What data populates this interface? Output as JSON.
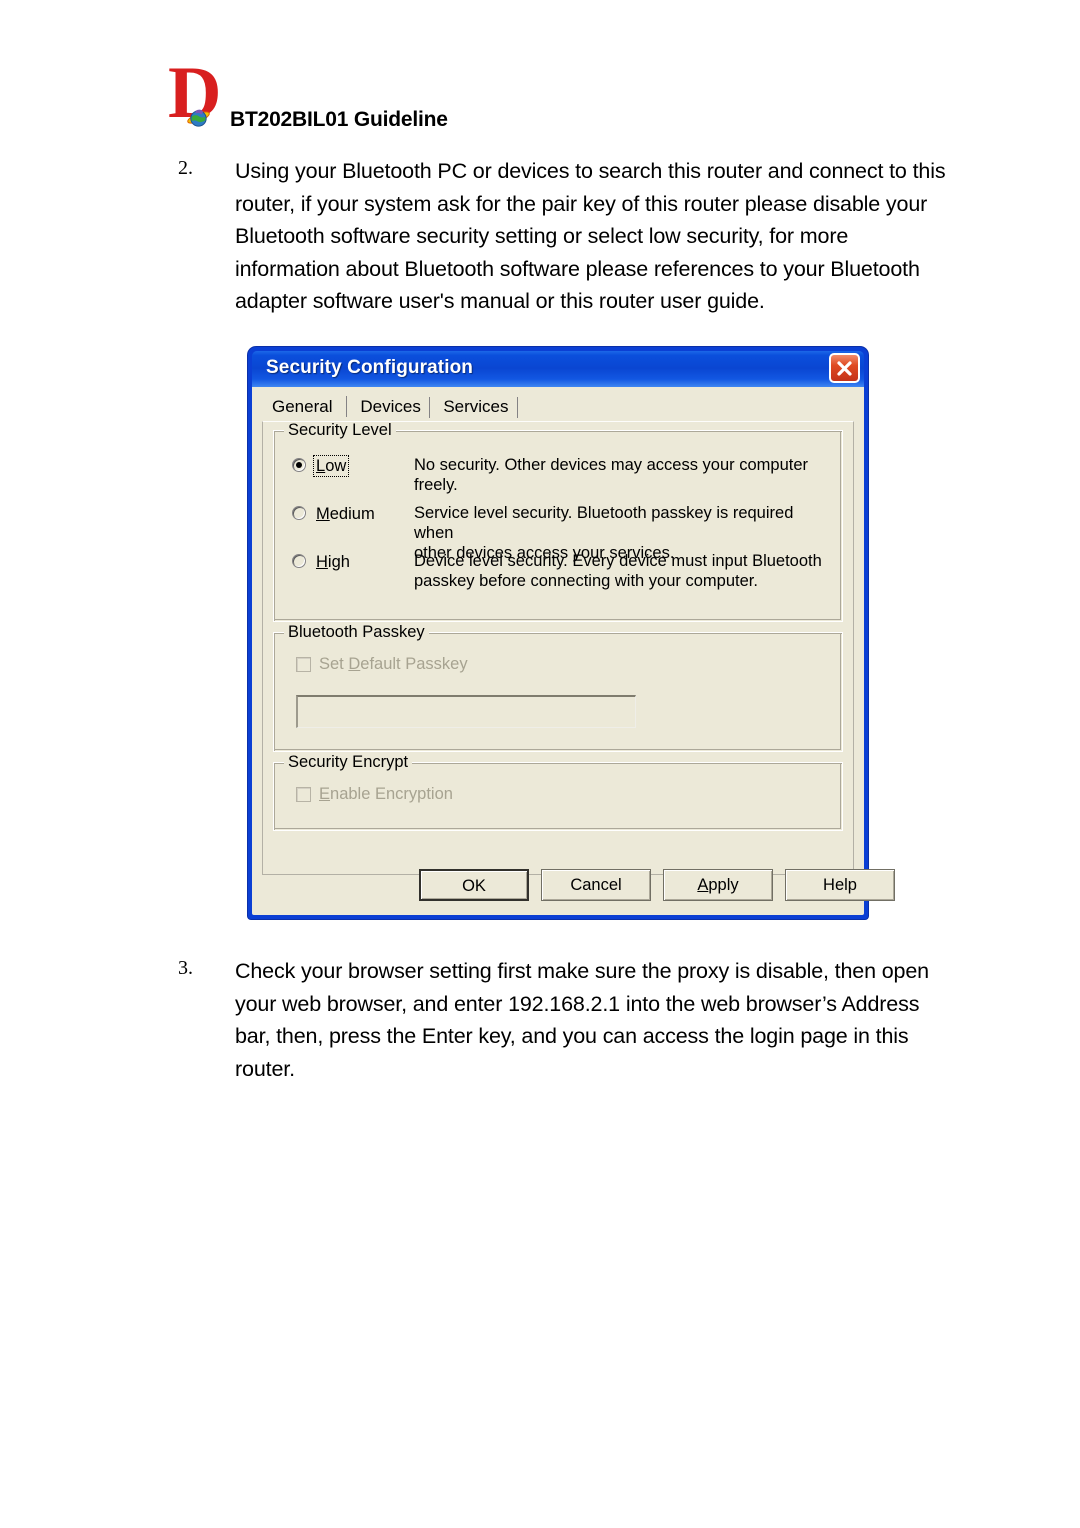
{
  "header": {
    "logo_letter": "D",
    "title": "BT202BIL01 Guideline"
  },
  "steps": [
    {
      "number": "2.",
      "text": "Using your Bluetooth PC or devices to search this router and connect to this router, if your system ask for the pair key of this router please disable your Bluetooth software security setting or select low security, for more information about Bluetooth software please references to your Bluetooth adapter software user's manual or this router user guide."
    },
    {
      "number": "3.",
      "text": "Check your browser setting first make sure the proxy is disable, then open your web browser, and enter 192.168.2.1 into the web browser’s Address bar, then, press the Enter key, and you can access the login page in this router."
    }
  ],
  "dialog": {
    "title": "Security Configuration",
    "close_label": "✕",
    "tabs": [
      {
        "label": "General",
        "active": true
      },
      {
        "label": "Devices",
        "active": false
      },
      {
        "label": "Services",
        "active": false
      }
    ],
    "security_level": {
      "group_title": "Security Level",
      "options": [
        {
          "label": "Low",
          "accel": "L",
          "selected": true,
          "focused": true,
          "desc_line1": "No security. Other devices may access your computer freely.",
          "desc_line2": ""
        },
        {
          "label": "Medium",
          "accel": "M",
          "selected": false,
          "focused": false,
          "desc_line1": "Service level security. Bluetooth passkey is required when",
          "desc_line2": "other devices access your services."
        },
        {
          "label": "High",
          "accel": "H",
          "selected": false,
          "focused": false,
          "desc_line1": "Device level security. Every device must input Bluetooth",
          "desc_line2": "passkey before connecting with your computer."
        }
      ]
    },
    "passkey": {
      "group_title": "Bluetooth Passkey",
      "checkbox_label": "Set Default Passkey",
      "checkbox_accel": "D",
      "checkbox_checked": false,
      "checkbox_disabled": true,
      "input_value": "",
      "input_disabled": true
    },
    "encrypt": {
      "group_title": "Security Encrypt",
      "checkbox_label": "Enable Encryption",
      "checkbox_accel": "E",
      "checkbox_checked": false,
      "checkbox_disabled": true
    },
    "buttons": [
      {
        "label": "OK",
        "default": true,
        "accel": ""
      },
      {
        "label": "Cancel",
        "default": false,
        "accel": ""
      },
      {
        "label": "Apply",
        "default": false,
        "accel": "A"
      },
      {
        "label": "Help",
        "default": false,
        "accel": ""
      }
    ]
  },
  "colors": {
    "titlebar_blue": "#0b4fdc",
    "frame_blue": "#0b3fd4",
    "dialog_face": "#ece9d8",
    "close_red": "#df4a22",
    "logo_red": "#d81f1f",
    "disabled_text": "#a7a391"
  }
}
